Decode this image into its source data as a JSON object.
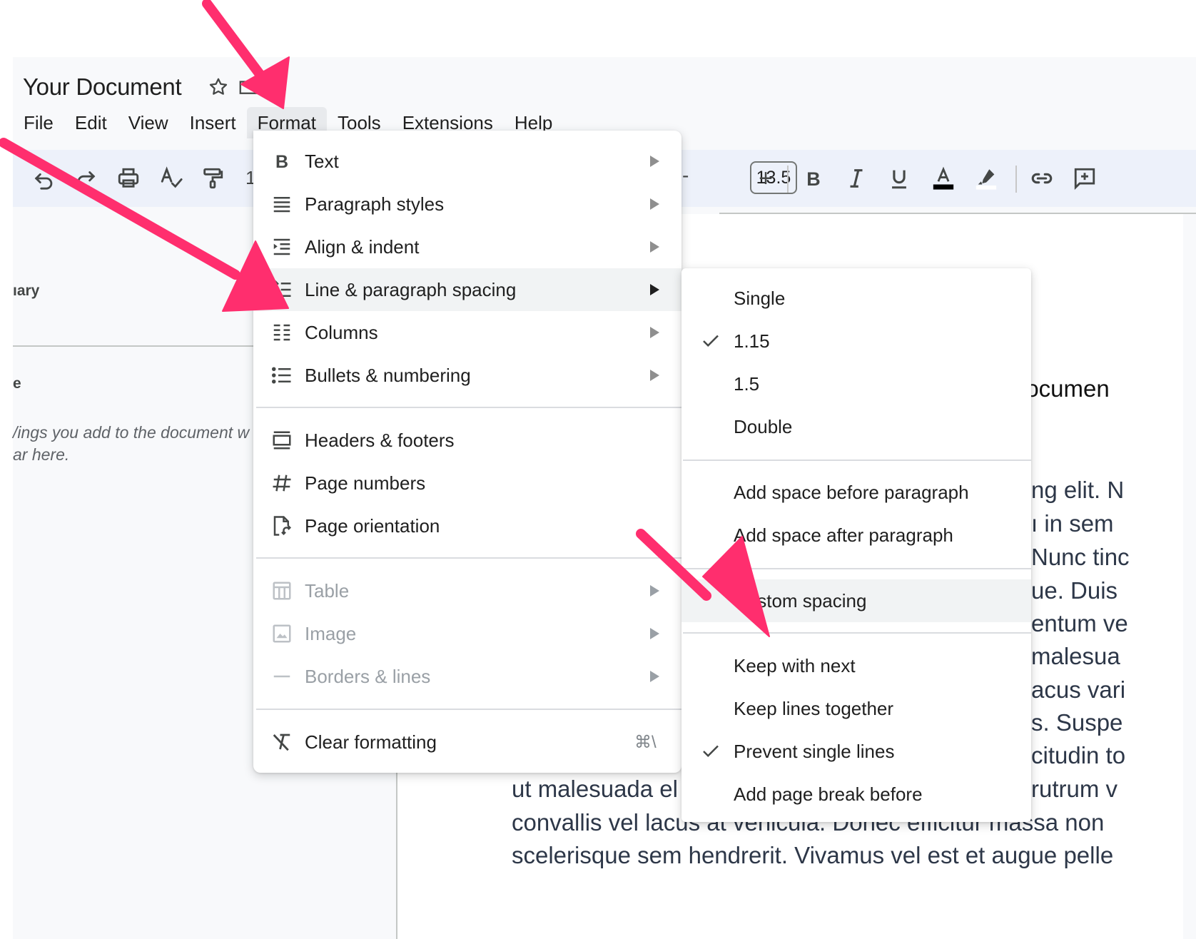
{
  "header": {
    "doc_title": "Your Document",
    "menus": [
      "File",
      "Edit",
      "View",
      "Insert",
      "Format",
      "Tools",
      "Extensions",
      "Help"
    ],
    "active_menu": "Format"
  },
  "toolbar": {
    "partial_zoom_digit": "1",
    "font_size": "13.5",
    "font_size_decrease": "-",
    "font_size_increase": "+",
    "text_color": "#000000",
    "highlight_color": "#ffffff"
  },
  "sidebar": {
    "summary_partial": "ıary",
    "outline_partial": "e",
    "hint_line1": "/ings you add to the document w",
    "hint_line2": "ar here."
  },
  "document": {
    "heading_partial": "locumen",
    "right_lines": [
      "ng elit. N",
      "ı in sem",
      "Nunc tinc",
      "ue. Duis",
      "entum ve",
      "malesua",
      "acus vari",
      "s. Suspe",
      "citudin to",
      "rutrum v"
    ],
    "bottom_lines": [
      "ut malesuada el",
      "convallis vel lacus at vehicula. Donec efficitur massa non",
      "scelerisque sem hendrerit. Vivamus vel est et augue pelle"
    ]
  },
  "format_menu": {
    "items": [
      {
        "label": "Text",
        "icon": "bold-icon",
        "submenu": true
      },
      {
        "label": "Paragraph styles",
        "icon": "paragraph-styles-icon",
        "submenu": true
      },
      {
        "label": "Align & indent",
        "icon": "align-indent-icon",
        "submenu": true
      },
      {
        "label": "Line & paragraph spacing",
        "icon": "line-spacing-icon",
        "submenu": true,
        "highlighted": true
      },
      {
        "label": "Columns",
        "icon": "columns-icon",
        "submenu": true
      },
      {
        "label": "Bullets & numbering",
        "icon": "bullets-icon",
        "submenu": true
      },
      {
        "label": "Headers & footers",
        "icon": "headers-footers-icon"
      },
      {
        "label": "Page numbers",
        "icon": "hash-icon"
      },
      {
        "label": "Page orientation",
        "icon": "page-orientation-icon"
      },
      {
        "label": "Table",
        "icon": "table-icon",
        "submenu": true,
        "disabled": true
      },
      {
        "label": "Image",
        "icon": "image-icon",
        "submenu": true,
        "disabled": true
      },
      {
        "label": "Borders & lines",
        "icon": "borders-lines-icon",
        "submenu": true,
        "disabled": true
      },
      {
        "label": "Clear formatting",
        "icon": "clear-formatting-icon",
        "shortcut": "⌘\\"
      }
    ]
  },
  "spacing_submenu": {
    "items": [
      {
        "label": "Single",
        "checked": false
      },
      {
        "label": "1.15",
        "checked": true
      },
      {
        "label": "1.5",
        "checked": false
      },
      {
        "label": "Double",
        "checked": false
      },
      {
        "label": "Add space before paragraph",
        "checked": false
      },
      {
        "label": "Add space after paragraph",
        "checked": false
      },
      {
        "label": "Custom spacing",
        "checked": false,
        "highlighted": true
      },
      {
        "label": "Keep with next",
        "checked": false
      },
      {
        "label": "Keep lines together",
        "checked": false
      },
      {
        "label": "Prevent single lines",
        "checked": true
      },
      {
        "label": "Add page break before",
        "checked": false
      }
    ]
  },
  "annotations": {
    "arrow_color": "#ff2e6e"
  }
}
